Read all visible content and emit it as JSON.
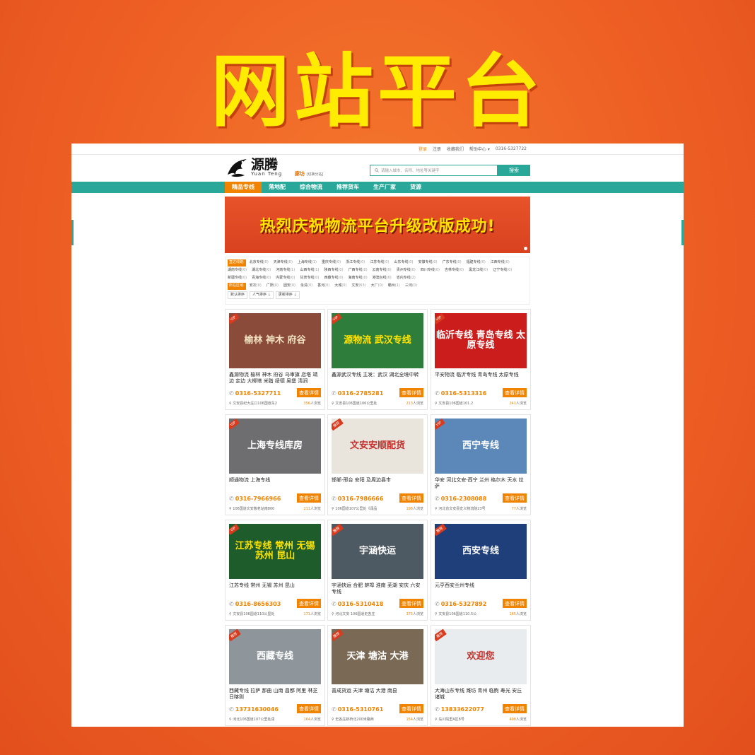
{
  "headline": "网站平台",
  "topbar": {
    "items": [
      {
        "label": "登录",
        "active": true
      },
      {
        "label": "注册"
      },
      {
        "label": "收藏我们"
      },
      {
        "label": "帮助中心 ▾"
      },
      {
        "label": "0316-5327722"
      }
    ]
  },
  "logo": {
    "cn": "源腾",
    "en": "Yuan Teng"
  },
  "city": {
    "name": "廊坊",
    "switch": "[切换分站]"
  },
  "search": {
    "placeholder": "请输入城市、名称、地址等关键字",
    "button": "搜索"
  },
  "nav": [
    {
      "label": "精品专线",
      "active": true
    },
    {
      "label": "落地配"
    },
    {
      "label": "综合物流"
    },
    {
      "label": "推荐货车"
    },
    {
      "label": "生产厂家"
    },
    {
      "label": "货源"
    }
  ],
  "banner": {
    "text": "热烈庆祝物流平台升级改版成功!"
  },
  "filters": {
    "line_tag": "直达线路:",
    "lines": [
      {
        "name": "北京专线",
        "count": "(0)"
      },
      {
        "name": "天津专线",
        "count": "(0)"
      },
      {
        "name": "上海专线",
        "count": "(1)"
      },
      {
        "name": "重庆专线",
        "count": "(0)"
      },
      {
        "name": "浙江专线",
        "count": "(0)"
      },
      {
        "name": "江苏专线",
        "count": "(0)"
      },
      {
        "name": "山东专线",
        "count": "(0)"
      },
      {
        "name": "安徽专线",
        "count": "(0)"
      },
      {
        "name": "广东专线",
        "count": "(0)"
      },
      {
        "name": "福建专线",
        "count": "(0)"
      },
      {
        "name": "江西专线",
        "count": "(0)"
      },
      {
        "name": "湖南专线",
        "count": "(0)"
      },
      {
        "name": "湖北专线",
        "count": "(0)"
      },
      {
        "name": "河南专线",
        "count": "(1)"
      },
      {
        "name": "山西专线",
        "count": "(1)"
      },
      {
        "name": "陕西专线",
        "count": "(0)"
      },
      {
        "name": "广西专线",
        "count": "(0)"
      },
      {
        "name": "云南专线",
        "count": "(0)"
      },
      {
        "name": "贵州专线",
        "count": "(0)"
      },
      {
        "name": "四川专线",
        "count": "(0)"
      },
      {
        "name": "吉林专线",
        "count": "(0)"
      },
      {
        "name": "黑龙江线",
        "count": "(0)"
      },
      {
        "name": "辽宁专线",
        "count": "(0)"
      },
      {
        "name": "新疆专线",
        "count": "(0)"
      },
      {
        "name": "青海专线",
        "count": "(0)"
      },
      {
        "name": "内蒙专线",
        "count": "(0)"
      },
      {
        "name": "甘肃专线",
        "count": "(0)"
      },
      {
        "name": "西藏专线",
        "count": "(0)"
      },
      {
        "name": "海南专线",
        "count": "(0)"
      },
      {
        "name": "港澳台线",
        "count": "(0)"
      },
      {
        "name": "省内专线",
        "count": "(2)"
      }
    ],
    "area_tag": "所在区域:",
    "areas": [
      {
        "name": "安次",
        "count": "(0)"
      },
      {
        "name": "广阳",
        "count": "(0)"
      },
      {
        "name": "固安",
        "count": "(0)"
      },
      {
        "name": "永清",
        "count": "(0)"
      },
      {
        "name": "香河",
        "count": "(0)"
      },
      {
        "name": "大城",
        "count": "(0)"
      },
      {
        "name": "文安",
        "count": "(63)"
      },
      {
        "name": "大厂",
        "count": "(0)"
      },
      {
        "name": "霸州",
        "count": "(1)"
      },
      {
        "name": "三河",
        "count": "(0)"
      }
    ],
    "sort": [
      "默认排序",
      "人气排序 ⇣",
      "更新排序 ⇣"
    ]
  },
  "cards": [
    {
      "badge": "VIP",
      "img_text": "榆林 神木 府谷",
      "img_color": "#8a4b3a",
      "img_text_color": "#f4e3c3",
      "title": "鑫源物流 榆林 神木 府谷 乌审旗 店塔 靖边 定边 大柳塔 米脂 绥德 吴堡 清涧",
      "phone": "0316-5327711",
      "btn": "查看详情",
      "addr": "文安县纪大庄口106国道东2",
      "views": "356",
      "views_suffix": "人浏览"
    },
    {
      "badge": "VIP",
      "img_text": "源物流 武汉专线",
      "img_color": "#2f7d3a",
      "img_text_color": "#ffe400",
      "title": "鑫源武汉专线 主发：武汉 湖北全境中转",
      "phone": "0316-2785281",
      "btn": "查看详情",
      "addr": "文安县106国道106公里处",
      "views": "213",
      "views_suffix": "人浏览"
    },
    {
      "badge": "VIP",
      "img_text": "临沂专线 青岛专线 太原专线",
      "img_color": "#cc1d1d",
      "img_text_color": "#ffffff",
      "title": "平安物流 临沂专线 青岛专线 太原专线",
      "phone": "0316-5313316",
      "btn": "查看详情",
      "addr": "文安县106国道101.2",
      "views": "241",
      "views_suffix": "人浏览"
    },
    {
      "badge": "VIP",
      "img_text": "上海专线库房",
      "img_color": "#6e6e70",
      "img_text_color": "#ffffff",
      "title": "顺通物流 上海专线",
      "phone": "0316-7966966",
      "btn": "查看详情",
      "addr": "106国道文安敬老站南800",
      "views": "211",
      "views_suffix": "人浏览"
    },
    {
      "badge": "推荐",
      "img_text": "文安安顺配货",
      "img_color": "#e9e4dc",
      "img_text_color": "#c4302b",
      "title": "邯郸-邢台 安阳 及周边县市",
      "phone": "0316-7986666",
      "btn": "查看详情",
      "addr": "106国道107公里处《润品",
      "views": "198",
      "views_suffix": "人浏览"
    },
    {
      "badge": "VIP",
      "img_text": "西宁专线",
      "img_color": "#5b88b8",
      "img_text_color": "#ffffff",
      "title": "华安 河北文安-西宁 兰州 格尔木 天水 拉萨",
      "phone": "0316-2308088",
      "btn": "查看详情",
      "addr": "河北省文安县史义物流院23号",
      "views": "77",
      "views_suffix": "人浏览"
    },
    {
      "badge": "VIP",
      "img_text": "江苏专线 常州 无锡 苏州 昆山",
      "img_color": "#1f5c2c",
      "img_text_color": "#ffe400",
      "title": "江苏专线 常州 无锡 苏州 昆山",
      "phone": "0316-8656303",
      "btn": "查看详情",
      "addr": "文安县106国道110公里处",
      "views": "171",
      "views_suffix": "人浏览"
    },
    {
      "badge": "推荐",
      "img_text": "宇涵快运",
      "img_color": "#4e5a63",
      "img_text_color": "#ffffff",
      "title": "宇涵快运 合肥 蚌埠 淮南 芜湖 安庆 六安专线",
      "phone": "0316-5310418",
      "btn": "查看详情",
      "addr": "河北文安 106国道史各庄",
      "views": "375",
      "views_suffix": "人浏览"
    },
    {
      "badge": "推荐",
      "img_text": "西安专线",
      "img_color": "#1e3f7a",
      "img_text_color": "#ffffff",
      "title": "元亨西安兰州专线",
      "phone": "0316-5327892",
      "btn": "查看详情",
      "addr": "文安县106国道110.5公",
      "views": "165",
      "views_suffix": "人浏览"
    },
    {
      "badge": "推荐",
      "img_text": "西藏专线",
      "img_color": "#8e969c",
      "img_text_color": "#ffffff",
      "title": "西藏专线 拉萨 那曲 山南 昌都 阿里 林芝 日喀则",
      "phone": "13731630046",
      "btn": "查看详情",
      "addr": "河北106国道107公里处润",
      "views": "164",
      "views_suffix": "人浏览"
    },
    {
      "badge": "推荐",
      "img_text": "天津 塘沽 大港",
      "img_color": "#7a6a55",
      "img_text_color": "#ffffff",
      "title": "喜成货运 天津 塘沽 大港 南县",
      "phone": "0316-5310761",
      "btn": "查看详情",
      "addr": "史各庄新桥北200米路西",
      "views": "154",
      "views_suffix": "人浏览"
    },
    {
      "badge": "推荐",
      "img_text": "欢迎您",
      "img_color": "#e8ecef",
      "img_text_color": "#c4302b",
      "title": "大海山东专线 潍坊 青州 临朐 寿光 安丘 诸城",
      "phone": "13833622077",
      "btn": "查看详情",
      "addr": "岛川院里A区8号",
      "views": "408",
      "views_suffix": "人浏览"
    }
  ]
}
